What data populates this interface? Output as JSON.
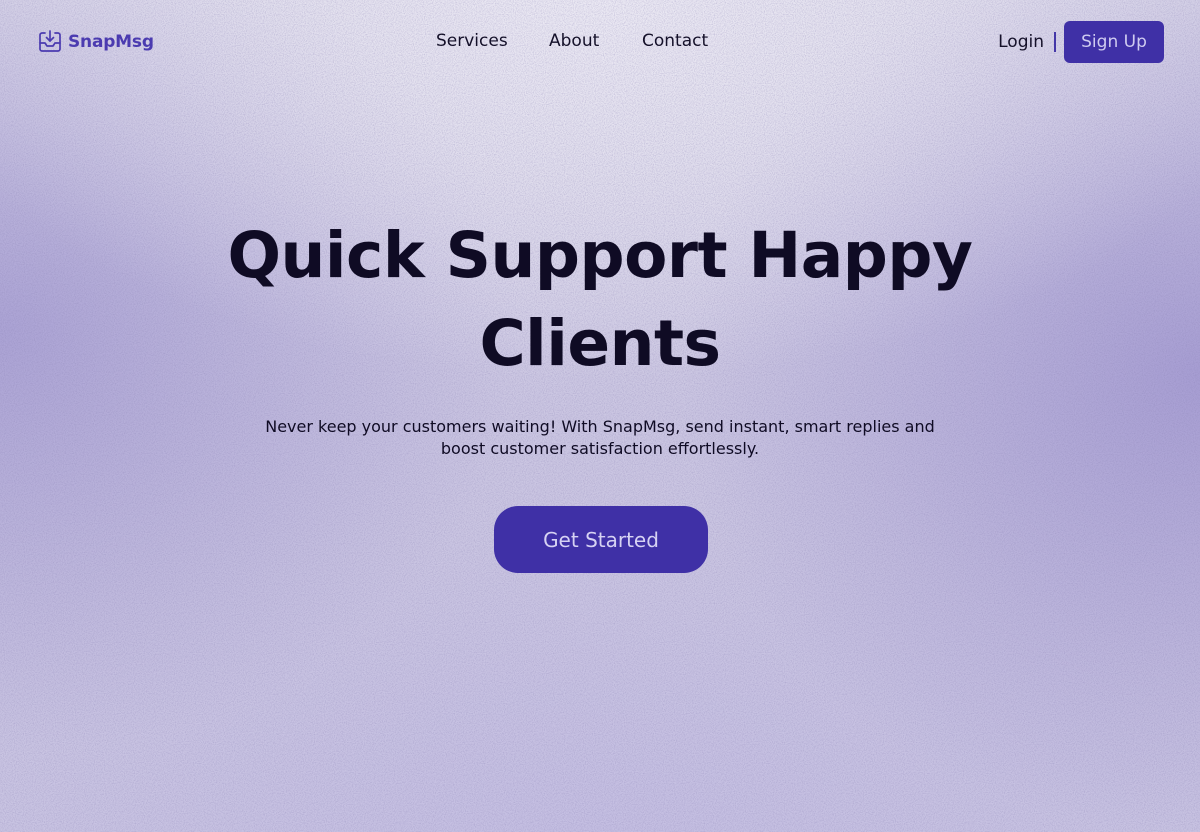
{
  "brand": {
    "name": "SnapMsg",
    "logo_icon": "inbox-download-icon",
    "color": "#4b3bb0"
  },
  "nav": {
    "items": [
      {
        "label": "Services"
      },
      {
        "label": "About"
      },
      {
        "label": "Contact"
      }
    ]
  },
  "auth": {
    "login_label": "Login",
    "signup_label": "Sign Up"
  },
  "hero": {
    "title_line1": "Quick Support Happy",
    "title_line2": "Clients",
    "subtitle": "Never keep your customers waiting! With SnapMsg, send instant, smart replies and boost customer satisfaction effortlessly.",
    "cta_label": "Get Started"
  },
  "colors": {
    "accent": "#3f30a6",
    "text": "#0f0b24"
  }
}
